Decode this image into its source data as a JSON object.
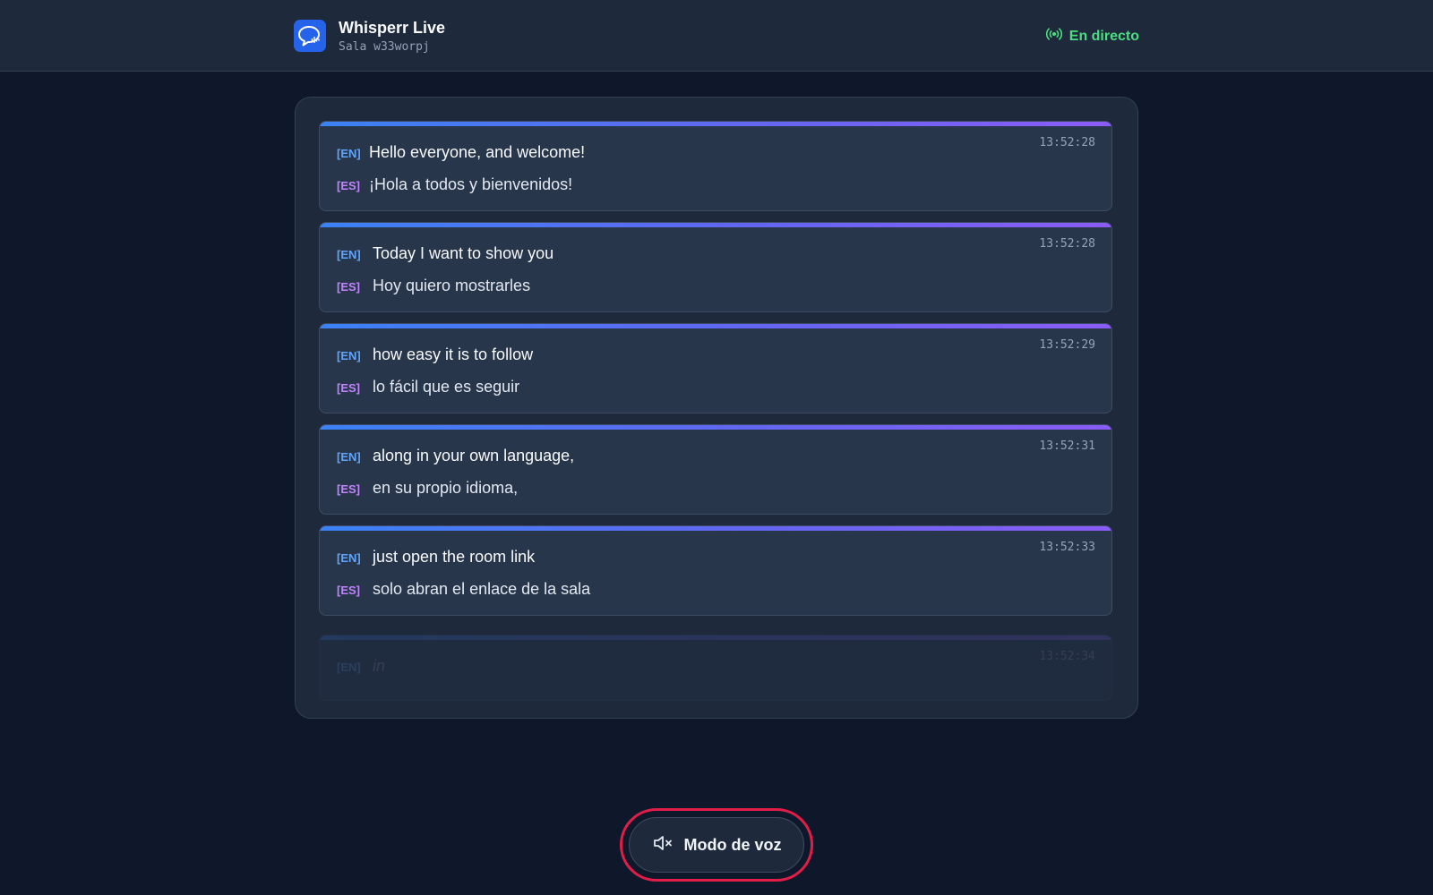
{
  "header": {
    "app_name": "Whisperr Live",
    "room_label": "Sala w33worpj",
    "status_label": "En directo",
    "status_color": "#4ade80",
    "logo_icon": "chat-bubble-soundwave-icon",
    "status_icon": "broadcast-icon"
  },
  "transcript": {
    "entries": [
      {
        "en_tag": "[EN]",
        "en_text": "Hello everyone, and welcome!",
        "es_tag": "[ES]",
        "es_text": "¡Hola a todos y bienvenidos!",
        "time": "13:52:28"
      },
      {
        "en_tag": "[EN]",
        "en_text": "Today I want to show you",
        "es_tag": "[ES]",
        "es_text": "Hoy quiero mostrarles",
        "time": "13:52:28"
      },
      {
        "en_tag": "[EN]",
        "en_text": "how easy it is to follow",
        "es_tag": "[ES]",
        "es_text": "lo fácil que es seguir",
        "time": "13:52:29"
      },
      {
        "en_tag": "[EN]",
        "en_text": "along in your own language,",
        "es_tag": "[ES]",
        "es_text": "en su propio idioma,",
        "time": "13:52:31"
      },
      {
        "en_tag": "[EN]",
        "en_text": "just open the room link",
        "es_tag": "[ES]",
        "es_text": "solo abran el enlace de la sala",
        "time": "13:52:33"
      },
      {
        "en_tag": "[EN]",
        "en_text": "in",
        "time": "13:52:34"
      }
    ]
  },
  "footer": {
    "voice_mode_label": "Modo de voz",
    "voice_icon": "speaker-muted-icon"
  },
  "colors": {
    "background": "#0f172a",
    "accent_blue": "#3b82f6",
    "accent_purple": "#8b5cf6",
    "en_tag": "#60a5fa",
    "es_tag": "#c084fc",
    "highlight": "#e11d48"
  }
}
